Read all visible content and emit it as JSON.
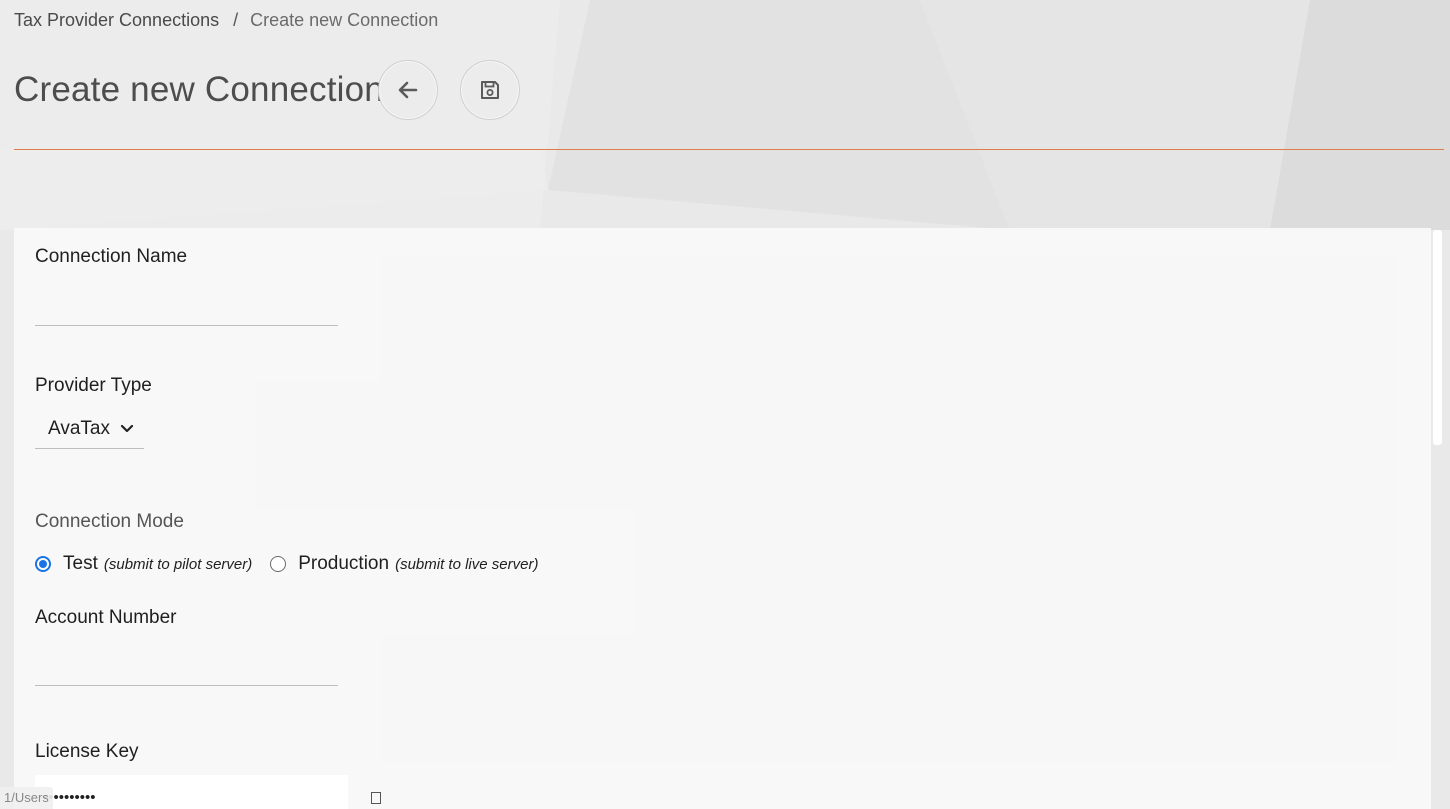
{
  "breadcrumb": {
    "parent": "Tax Provider Connections",
    "separator": "/",
    "current": "Create new Connection"
  },
  "header": {
    "title": "Create new Connection",
    "back_icon": "arrow-left-icon",
    "save_icon": "floppy-disk-icon"
  },
  "colors": {
    "accent_divider": "#e07b4a",
    "radio_selected": "#1a73e8"
  },
  "form": {
    "connection_name": {
      "label": "Connection Name",
      "value": ""
    },
    "provider_type": {
      "label": "Provider Type",
      "selected": "AvaTax",
      "icon": "chevron-down-icon"
    },
    "connection_mode": {
      "label": "Connection Mode",
      "options": [
        {
          "label": "Test",
          "hint": "(submit to pilot server)",
          "checked": true
        },
        {
          "label": "Production",
          "hint": "(submit to live server)",
          "checked": false
        }
      ]
    },
    "account_number": {
      "label": "Account Number",
      "value": ""
    },
    "license_key": {
      "label": "License Key",
      "masked_value": "••••••••••"
    }
  },
  "status_bar": {
    "url_fragment": "1/Users"
  }
}
